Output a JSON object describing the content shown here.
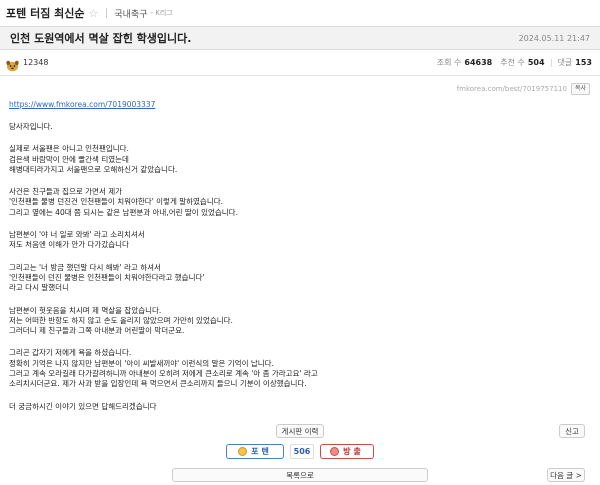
{
  "board": {
    "title": "포텐 터짐 최신순",
    "star_icon": "☆",
    "category": "국내축구",
    "category_sub": "- K리그"
  },
  "post": {
    "title": "인천 도원역에서 멱살 잡힌 학생입니다.",
    "date": "2024.05.11 21:47",
    "author": "12348",
    "stats": {
      "views_label": "조회 수",
      "views": "64638",
      "likes_label": "추천 수",
      "likes": "504",
      "comments_label": "댓글",
      "comments": "153"
    },
    "permalink": "fmkorea.com/best/7019757110",
    "copy_label": "복사",
    "link": "https://www.fmkorea.com/7019003337",
    "paragraphs": [
      [
        "당사자입니다."
      ],
      [
        "실제로 서울팬은 아니고 인천팬입니다.",
        "검은색 바람막이 안에 빨간색 티였는데",
        "해병대티라가지고 서울팬으로 오해하신거 같았습니다."
      ],
      [
        "사건은 친구들과 집으로 가면서 제가",
        "'인천팬들 물병 던진건 인천팬들이 치워야한다' 이렇게 말하였습니다.",
        "그리고 옆에는 40대 쯤 되시는 같은 남편분과 아내,어린 딸이 있었습니다."
      ],
      [
        "남편분이 '야 너 일로 와봐' 라고 소리치셔서",
        "저도 처음엔 이해가 안가 다가갔습니다"
      ],
      [
        "그리고는 '너 방금 했던말 다시 해봐' 라고 하셔서",
        "'인천팬들이 던진 물병은 인천팬들이 치워야한다라고 했습니다'",
        "라고 다시 말했더니"
      ],
      [
        "남편분이 헛웃음을 치시며 제 멱살을 잡았습니다.",
        "저는 어떠한 반항도 하지 않고 손도 올리지 않았으며 가만히 있었습니다.",
        "그러더니 제 친구들과 그쪽 아내분과 어린딸이 막더군요."
      ],
      [
        "그리곤 갑자기 저에게 욕을 하셨습니다.",
        "정확히 기억은 나지 않지만 남편분이 '아이 씨발새끼야' 이런식의 말은 기억이 납니다.",
        "그러고 계속 오라길래 다가갈려하니까 아내분이 오히려 저에게 큰소리로 계속 '아 좀 가라고요' 라고",
        "소리치시더군요. 제가 사과 받을 입장인데 욕 먹으면서 큰소리까지 들으니 기분이 이상했습니다."
      ],
      [
        "더 궁금하시긴 이야기 있으면 답해드리겠습니다"
      ]
    ]
  },
  "actions": {
    "board_history": "게시판 이력",
    "report": "신고",
    "vote_up": "포텐",
    "vote_count": "506",
    "vote_down": "방출",
    "list": "목록으로",
    "next": "다음 글 >"
  }
}
